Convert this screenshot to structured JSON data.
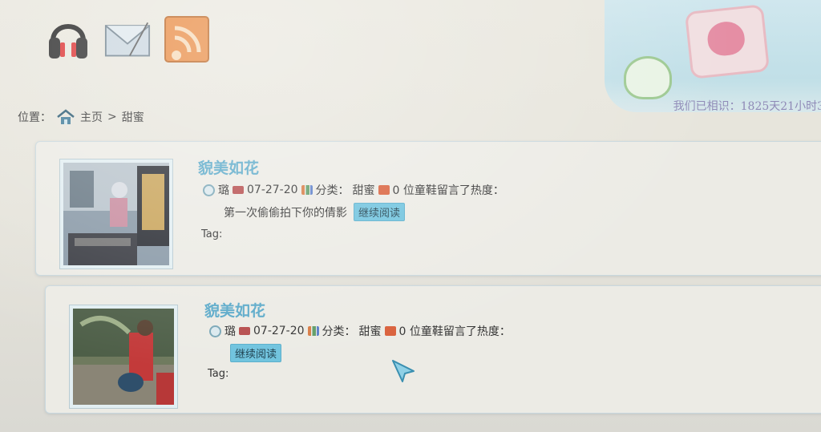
{
  "top_icons": [
    {
      "name": "headphones-icon"
    },
    {
      "name": "mail-icon"
    },
    {
      "name": "rss-icon"
    }
  ],
  "banner": {
    "text": "我们已相识：1825天21小时3"
  },
  "breadcrumb": {
    "label": "位置：",
    "home": "主页",
    "separator": ">",
    "current": "甜蜜"
  },
  "posts": [
    {
      "title": "貌美如花",
      "author": "璐",
      "date": "07-27-20",
      "category_label": "分类：",
      "category": "甜蜜",
      "comments": "0 位童鞋留言了热度：",
      "excerpt": "第一次偷偷拍下你的倩影",
      "read_more": "继续阅读",
      "tag_label": "Tag:"
    },
    {
      "title": "貌美如花",
      "author": "璐",
      "date": "07-27-20",
      "category_label": "分类：",
      "category": "甜蜜",
      "comments": "0 位童鞋留言了热度：",
      "excerpt": "",
      "read_more": "继续阅读",
      "tag_label": "Tag:"
    }
  ],
  "colors": {
    "accent": "#5aa9c9",
    "button": "#6fc3de",
    "page_bg": "#e7e5dc"
  }
}
